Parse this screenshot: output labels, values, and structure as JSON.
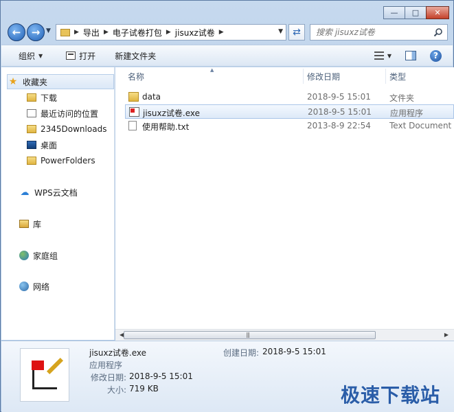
{
  "address_bar": {
    "breadcrumbs": [
      "导出",
      "电子试卷打包",
      "jisuxz试卷"
    ]
  },
  "search": {
    "placeholder": "搜索 jisuxz试卷"
  },
  "toolbar": {
    "organize_label": "组织",
    "open_label": "打开",
    "new_folder_label": "新建文件夹"
  },
  "sidebar": {
    "favorites_label": "收藏夹",
    "items": [
      {
        "label": "下载",
        "icon": "download-folder-icon"
      },
      {
        "label": "最近访问的位置",
        "icon": "recent-places-icon"
      },
      {
        "label": "2345Downloads",
        "icon": "folder-icon"
      },
      {
        "label": "桌面",
        "icon": "desktop-icon"
      },
      {
        "label": "PowerFolders",
        "icon": "folder-icon"
      }
    ],
    "wps_label": "WPS云文档",
    "library_label": "库",
    "homegroup_label": "家庭组",
    "network_label": "网络"
  },
  "file_list": {
    "columns": {
      "name": "名称",
      "modified": "修改日期",
      "type": "类型"
    },
    "rows": [
      {
        "name": "data",
        "modified": "2018-9-5 15:01",
        "type": "文件夹",
        "icon": "folder-icon"
      },
      {
        "name": "jisuxz试卷.exe",
        "modified": "2018-9-5 15:01",
        "type": "应用程序",
        "icon": "exe-icon"
      },
      {
        "name": "使用帮助.txt",
        "modified": "2013-8-9 22:54",
        "type": "Text Document",
        "icon": "txt-icon"
      }
    ]
  },
  "details": {
    "file_name": "jisuxz试卷.exe",
    "file_type": "应用程序",
    "modified_label": "修改日期:",
    "modified_value": "2018-9-5 15:01",
    "size_label": "大小:",
    "size_value": "719 KB",
    "created_label": "创建日期:",
    "created_value": "2018-9-5 15:01"
  },
  "watermark": "极速下载站"
}
